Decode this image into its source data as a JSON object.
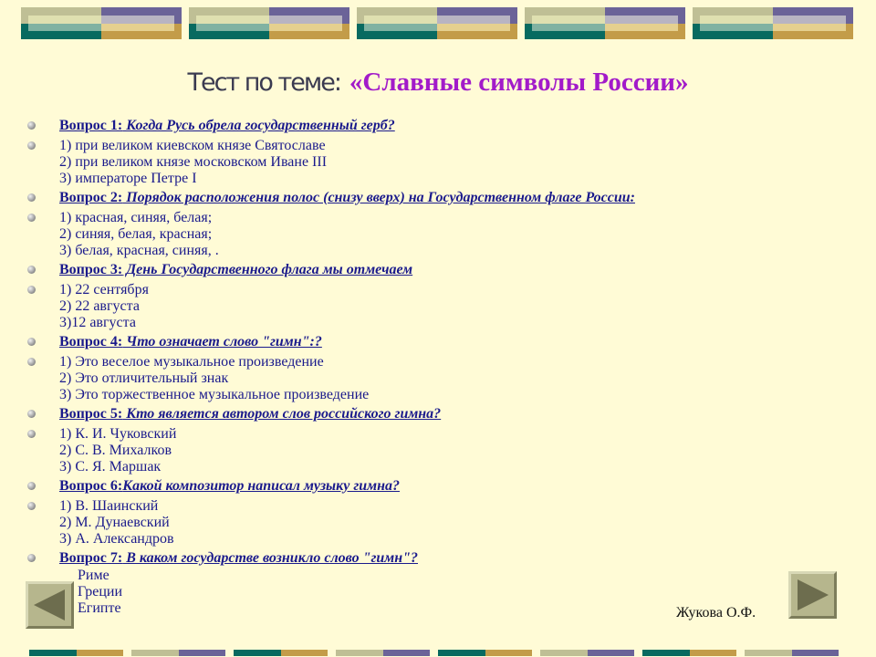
{
  "slide": {
    "title_prefix": "Тест по теме:",
    "title_topic": "«Славные символы России»",
    "colors": {
      "background": "#fffbd6",
      "title_prefix": "#3a3a50",
      "title_topic": "#a21bc9",
      "text": "#1a1a8c"
    }
  },
  "questions": [
    {
      "label": "Вопрос 1:",
      "text": " Когда Русь обрела государственный герб?",
      "answers": [
        "1) при великом киевском князе Святославе",
        "2) при великом князе московском Иване III",
        "3) императоре Петре I"
      ]
    },
    {
      "label": "Вопрос 2:",
      "text": " Порядок расположения полос (снизу вверх) на Государственном флаге России:",
      "answers": [
        "1) красная, синяя, белая;",
        "2) синяя, белая, красная;",
        "3) белая, красная, синяя, ."
      ]
    },
    {
      "label": "Вопрос 3:",
      "text": " День Государственного флага мы отмечаем",
      "answers": [
        "1) 22 сентября",
        "2) 22 августа",
        "3)12 августа"
      ]
    },
    {
      "label": "Вопрос 4:",
      "text": " Что означает слово \"гимн\":?",
      "answers": [
        "1) Это веселое музыкальное произведение",
        "2) Это отличительный знак",
        "3) Это торжественное музыкальное произведение"
      ]
    },
    {
      "label": "Вопрос 5:",
      "text": " Кто является автором слов российского гимна?",
      "answers": [
        "1) К. И. Чуковский",
        "2) С. В. Михалков",
        "3) С. Я. Маршак"
      ]
    },
    {
      "label": "Вопрос 6:",
      "text": "Какой композитор написал музыку гимна?",
      "answers": [
        "1) В. Шаинский",
        "2) М. Дунаевский",
        "3) А. Александров"
      ]
    },
    {
      "label": "Вопрос 7:",
      "text": " В каком государстве возникло слово \"гимн\"?",
      "answers": [
        "Риме",
        "Греции",
        "Египте"
      ]
    }
  ],
  "navigation": {
    "prev_icon": "triangle-left-icon",
    "next_icon": "triangle-right-icon"
  },
  "author": "Жукова О.Ф."
}
